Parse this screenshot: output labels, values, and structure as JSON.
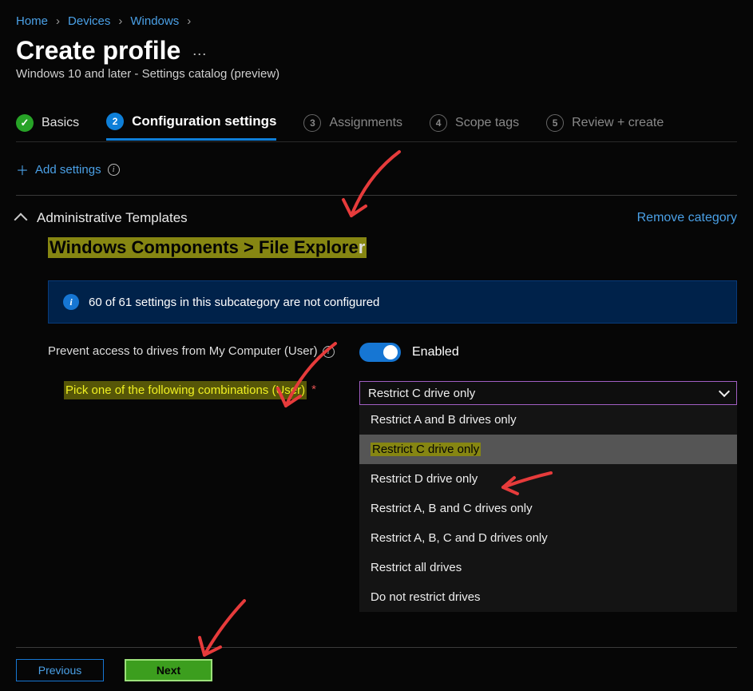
{
  "breadcrumb": {
    "items": [
      "Home",
      "Devices",
      "Windows"
    ]
  },
  "header": {
    "title": "Create profile",
    "subtitle": "Windows 10 and later - Settings catalog (preview)"
  },
  "stepper": {
    "steps": [
      {
        "num": "",
        "label": "Basics",
        "state": "done"
      },
      {
        "num": "2",
        "label": "Configuration settings",
        "state": "active"
      },
      {
        "num": "3",
        "label": "Assignments",
        "state": "pending"
      },
      {
        "num": "4",
        "label": "Scope tags",
        "state": "pending"
      },
      {
        "num": "5",
        "label": "Review + create",
        "state": "pending"
      }
    ]
  },
  "add_settings": {
    "label": "Add settings"
  },
  "section": {
    "title": "Administrative Templates",
    "remove_label": "Remove category",
    "category_path": "Windows Components > File Explore",
    "category_path_trail": "r",
    "banner": "60 of 61 settings in this subcategory are not configured",
    "setting_name": "Prevent access to drives from My Computer (User)",
    "toggle_label": "Enabled",
    "sub_setting_label": "Pick one of the following combinations (User)",
    "req_marker": "*",
    "select_value": "Restrict C drive only",
    "options": [
      "Restrict A and B drives only",
      "Restrict C drive only",
      "Restrict D drive only",
      "Restrict A, B and C drives only",
      "Restrict A, B, C and D drives only",
      "Restrict all drives",
      "Do not restrict drives"
    ],
    "selected_option_index": 1
  },
  "footer": {
    "previous": "Previous",
    "next": "Next"
  }
}
